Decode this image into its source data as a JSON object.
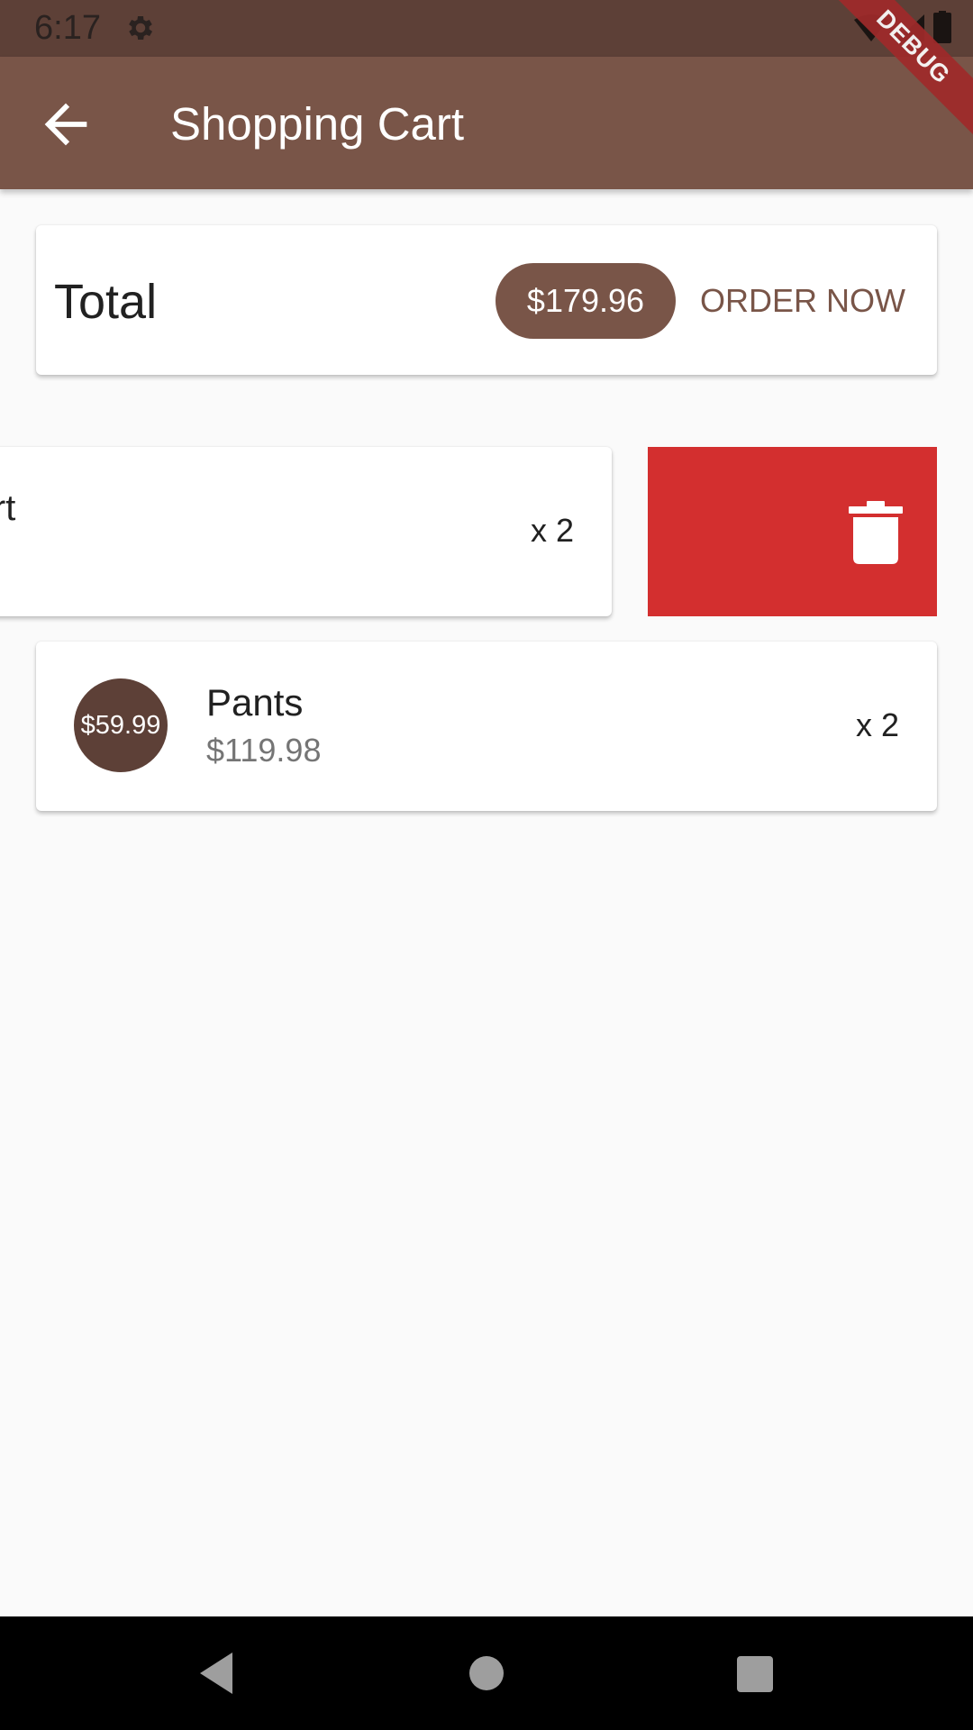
{
  "status_bar": {
    "time": "6:17",
    "icons": [
      "gear-icon",
      "wifi-icon",
      "signal-icon",
      "battery-icon"
    ]
  },
  "app_bar": {
    "title": "Shopping Cart",
    "back_icon": "arrow-back-icon",
    "debug_banner": "DEBUG"
  },
  "summary": {
    "total_label": "Total",
    "total_amount": "$179.96",
    "order_button": "ORDER NOW"
  },
  "cart_items": [
    {
      "title_visible": "irt",
      "quantity": "x 2",
      "swiped": true,
      "delete_icon": "trash-icon"
    },
    {
      "unit_price": "$59.99",
      "title": "Pants",
      "subtotal": "$119.98",
      "quantity": "x 2"
    }
  ],
  "colors": {
    "primary": "#795548",
    "primary_dark": "#5d4037",
    "delete": "#d32f2f",
    "background": "#fafafa"
  },
  "nav_bar": {
    "icons": [
      "nav-back-icon",
      "nav-home-icon",
      "nav-recents-icon"
    ]
  }
}
